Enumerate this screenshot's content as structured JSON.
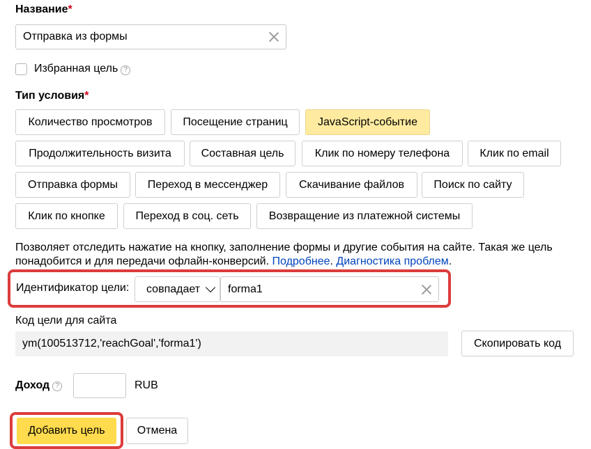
{
  "name_section": {
    "label": "Название",
    "required_mark": "*",
    "value": "Отправка из формы"
  },
  "favorite": {
    "label": "Избранная цель",
    "help_glyph": "?"
  },
  "condition_type": {
    "label": "Тип условия",
    "required_mark": "*",
    "options": [
      "Количество просмотров",
      "Посещение страниц",
      "JavaScript-событие",
      "Продолжительность визита",
      "Составная цель",
      "Клик по номеру телефона",
      "Клик по email",
      "Отправка формы",
      "Переход в мессенджер",
      "Скачивание файлов",
      "Поиск по сайту",
      "Клик по кнопке",
      "Переход в соц. сеть",
      "Возвращение из платежной системы"
    ],
    "selected": "JavaScript-событие"
  },
  "description": {
    "text_line1": "Позволяет отследить нажатие на кнопку, заполнение формы и другие события на сайте. Такая же цель",
    "text_line2": "понадобится и для передачи офлайн-конверсий.",
    "link_more": "Подробнее",
    "separator": ".",
    "link_diag": "Диагностика проблем",
    "end": "."
  },
  "goal_id": {
    "label": "Идентификатор цели:",
    "match_select": "совпадает",
    "value": "forma1"
  },
  "site_code": {
    "label": "Код цели для сайта",
    "code": "ym(100513712,'reachGoal','forma1')",
    "copy_button": "Скопировать код"
  },
  "income": {
    "label": "Доход",
    "help_glyph": "?",
    "value": "",
    "currency": "RUB"
  },
  "actions": {
    "add": "Добавить цель",
    "cancel": "Отмена"
  },
  "colors": {
    "accent_yellow": "#ffdb4d",
    "selected_chip": "#ffeba0",
    "link": "#0044bb",
    "highlight_red": "#dc3c3c",
    "required_red": "#d0021b"
  },
  "icons": [
    "clear-icon",
    "help-icon",
    "chevron-down-icon",
    "checkbox"
  ]
}
